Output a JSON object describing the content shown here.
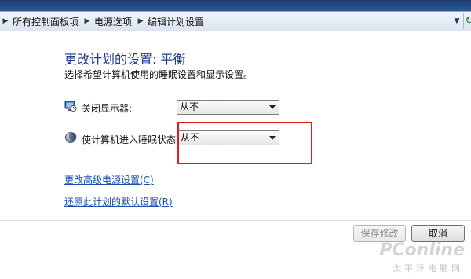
{
  "breadcrumb": [
    "所有控制面板项",
    "电源选项",
    "编辑计划设置"
  ],
  "page": {
    "title": "更改计划的设置: 平衡",
    "subtitle": "选择希望计算机使用的睡眠设置和显示设置。"
  },
  "settings": [
    {
      "label": "关闭显示器:",
      "value": "从不",
      "icon": "monitor-clock-icon"
    },
    {
      "label": "使计算机进入睡眠状态:",
      "value": "从不",
      "icon": "moon-sleep-icon"
    }
  ],
  "links": {
    "advanced": "更改高级电源设置(C)",
    "restore": "还原此计划的默认设置(R)"
  },
  "buttons": {
    "save": "保存修改",
    "cancel": "取消"
  },
  "watermark": {
    "main": "PConline",
    "sub": "太平洋电脑网"
  },
  "colors": {
    "title": "#1f3a93",
    "link": "#1b4fb0",
    "highlight_box": "#e21c1c"
  }
}
